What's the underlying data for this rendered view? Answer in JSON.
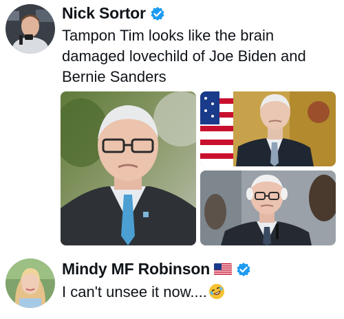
{
  "post": {
    "author_name": "Nick Sortor",
    "author_verified": true,
    "text_lines": [
      "Tampon Tim looks like the brain",
      "damaged lovechild of Joe Biden and",
      "Bernie Sanders"
    ],
    "media_count": 3
  },
  "reply": {
    "author_name": "Mindy MF Robinson",
    "author_flag": "us-flag-icon",
    "author_verified": true,
    "text": "I can't unsee it now....",
    "emoji": "rolling-on-floor-laughing-emoji"
  },
  "colors": {
    "verified_blue": "#1d9bf0",
    "text": "#0f1419"
  }
}
